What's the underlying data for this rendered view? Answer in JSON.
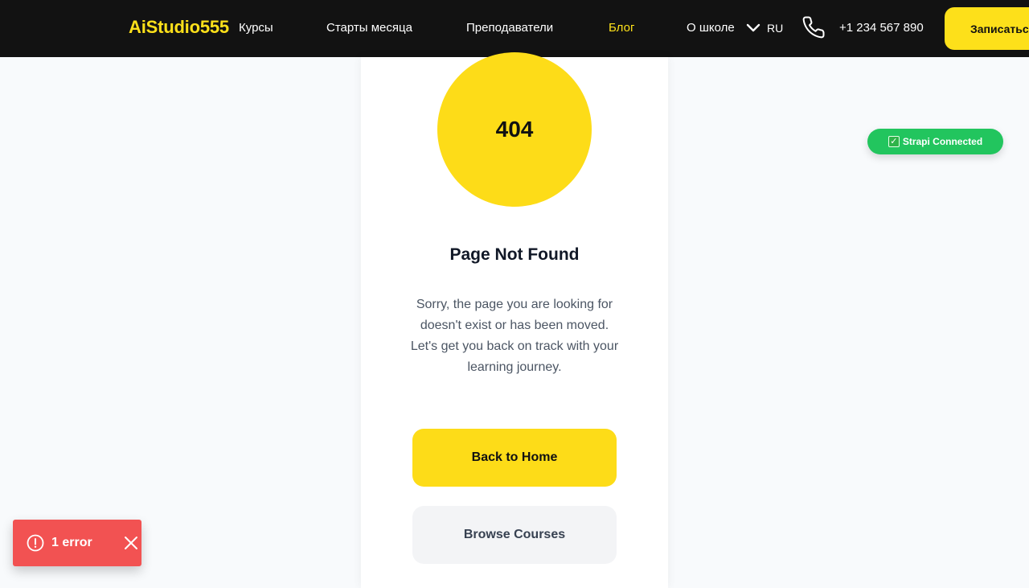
{
  "header": {
    "logo": "AiStudio555",
    "nav": [
      "Курсы",
      "Старты месяца",
      "Преподаватели",
      "Блог",
      "О школе"
    ],
    "active_nav": "Блог",
    "language": "RU",
    "phone": "+1 234 567 890",
    "cta_label": "Записаться",
    "accent_color": "#fde01a"
  },
  "error_page": {
    "code": "404",
    "title": "Page Not Found",
    "description": "Sorry, the page you are looking for doesn't exist or has been moved. Let's get you back on track with your learning journey.",
    "home_button": "Back to Home",
    "courses_button": "Browse Courses"
  },
  "status_badge": {
    "text": "Strapi Connected",
    "color": "#22c55e"
  },
  "error_toast": {
    "text": "1 error",
    "color": "#f25252"
  }
}
